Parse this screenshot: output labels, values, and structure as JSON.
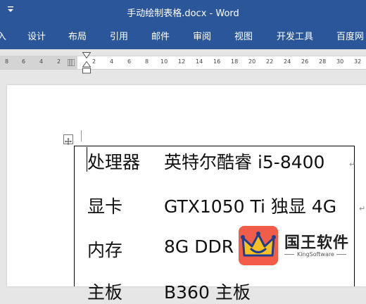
{
  "window": {
    "title": "手动绘制表格.docx - Word"
  },
  "ribbon": {
    "tabs": [
      "入",
      "设计",
      "布局",
      "引用",
      "邮件",
      "审阅",
      "视图",
      "开发工具",
      "百度网"
    ]
  },
  "ruler": {
    "left_numbers": [
      "8",
      "6",
      "4",
      "2"
    ],
    "right_numbers": [
      "2",
      "4",
      "6",
      "8",
      "10",
      "12",
      "14",
      "16",
      "18",
      "20",
      "22",
      "24",
      "26",
      "28",
      "30",
      "32"
    ]
  },
  "table": {
    "rows": [
      {
        "label": "处理器",
        "value": "英特尔酷睿 i5-8400",
        "mark": "↵"
      },
      {
        "label": "显卡",
        "value": "GTX1050 Ti 独显 4G",
        "mark": "↵"
      },
      {
        "label": "内存",
        "value": "8G DDR",
        "mark": ""
      },
      {
        "label": "主板",
        "value": "B360 主板",
        "mark": ""
      }
    ]
  },
  "watermark": {
    "name": "国王软件",
    "sub": "KingSoftware"
  },
  "colors": {
    "ribbon": "#2b579a",
    "logo": "#f25d4a"
  }
}
